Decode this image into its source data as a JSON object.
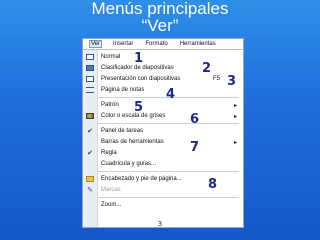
{
  "slide": {
    "title_line1": "Menús principales",
    "title_line2": "“Ver”",
    "page_number": "3"
  },
  "menubar": {
    "items": [
      "Ver",
      "Insertar",
      "Formato",
      "Herramientas"
    ]
  },
  "menu": {
    "items": [
      {
        "label": "Normal",
        "shortcut": "",
        "has_submenu": false,
        "checked": false,
        "disabled": false,
        "icon": "normal-view-icon"
      },
      {
        "label": "Clasificador de diapositivas",
        "shortcut": "",
        "has_submenu": false,
        "checked": false,
        "disabled": false,
        "icon": "slide-sorter-icon"
      },
      {
        "label": "Presentación con diapositivas",
        "shortcut": "F5",
        "has_submenu": false,
        "checked": false,
        "disabled": false,
        "icon": "slideshow-icon"
      },
      {
        "label": "Página de notas",
        "shortcut": "",
        "has_submenu": false,
        "checked": false,
        "disabled": false,
        "icon": "notes-page-icon"
      },
      {
        "label": "Patrón",
        "shortcut": "",
        "has_submenu": true,
        "checked": false,
        "disabled": false,
        "icon": ""
      },
      {
        "label": "Color o escala de grises",
        "shortcut": "",
        "has_submenu": true,
        "checked": false,
        "disabled": false,
        "icon": "color-scale-icon"
      },
      {
        "label": "Panel de tareas",
        "shortcut": "",
        "has_submenu": false,
        "checked": true,
        "disabled": false,
        "icon": "checkmark-icon"
      },
      {
        "label": "Barras de herramientas",
        "shortcut": "",
        "has_submenu": true,
        "checked": false,
        "disabled": false,
        "icon": ""
      },
      {
        "label": "Regla",
        "shortcut": "",
        "has_submenu": false,
        "checked": true,
        "disabled": false,
        "icon": "checkmark-icon"
      },
      {
        "label": "Cuadrícula y guías...",
        "shortcut": "",
        "has_submenu": false,
        "checked": false,
        "disabled": false,
        "icon": ""
      },
      {
        "label": "Encabezado y pie de página...",
        "shortcut": "",
        "has_submenu": false,
        "checked": false,
        "disabled": false,
        "icon": "header-footer-icon"
      },
      {
        "label": "Marcas",
        "shortcut": "",
        "has_submenu": false,
        "checked": false,
        "disabled": true,
        "icon": "markup-icon"
      },
      {
        "label": "Zoom...",
        "shortcut": "",
        "has_submenu": false,
        "checked": false,
        "disabled": false,
        "icon": ""
      }
    ]
  },
  "annotations": [
    "1",
    "2",
    "3",
    "4",
    "5",
    "6",
    "7",
    "8"
  ],
  "colors": {
    "background": "#1f6fdc",
    "annotation": "#1b2a8a",
    "menu_icon_column": "#e9eef6"
  }
}
